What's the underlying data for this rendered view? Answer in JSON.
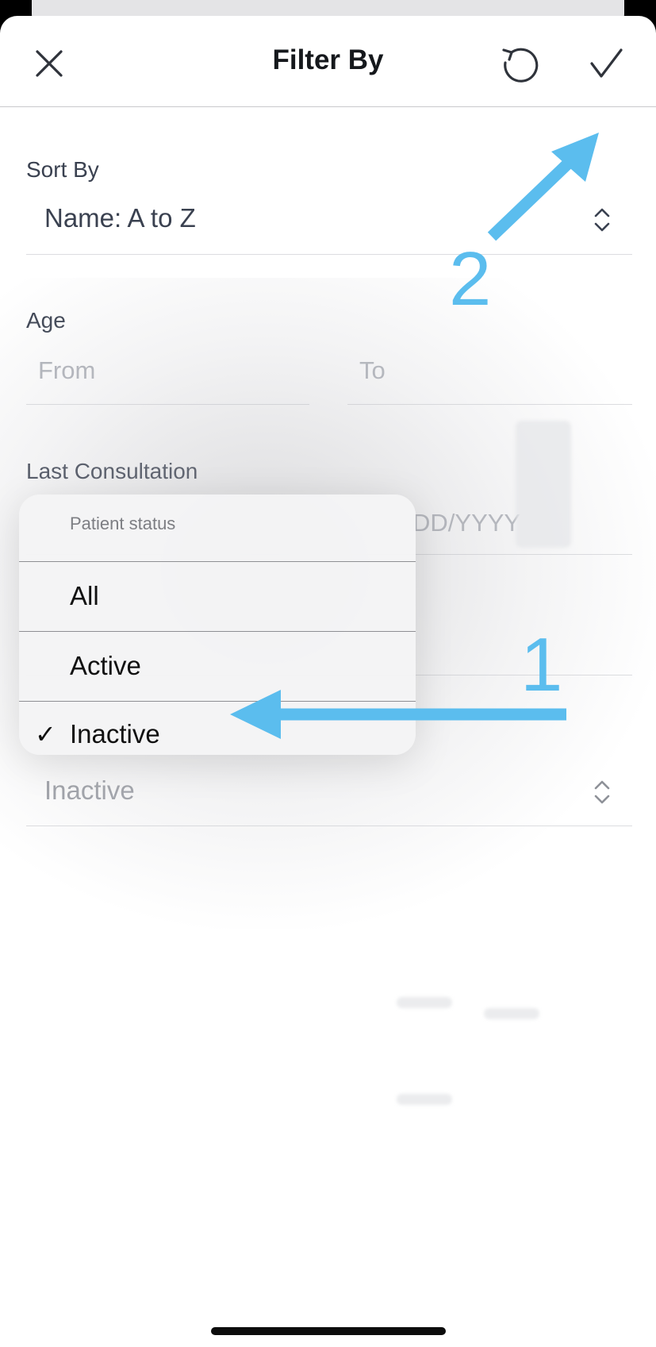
{
  "header": {
    "title": "Filter By",
    "close_icon": "close-icon",
    "reset_icon": "reset-icon",
    "apply_icon": "checkmark-icon"
  },
  "sort_by": {
    "label": "Sort By",
    "value": "Name: A to Z"
  },
  "age": {
    "label": "Age",
    "from_placeholder": "From",
    "to_placeholder": "To"
  },
  "last_consultation": {
    "label": "Last Consultation",
    "date_placeholder_visible": "DD/YYYY"
  },
  "patient_status": {
    "value": "Inactive"
  },
  "popover": {
    "title": "Patient status",
    "options": [
      "All",
      "Active",
      "Inactive"
    ],
    "selected": "Inactive",
    "check_glyph": "✓"
  },
  "annotations": {
    "step1": "1",
    "step2": "2",
    "color": "#5bbdee"
  },
  "colors": {
    "accent": "#5bbdee",
    "text": "#3a4150",
    "placeholder": "#b0b3ba"
  }
}
